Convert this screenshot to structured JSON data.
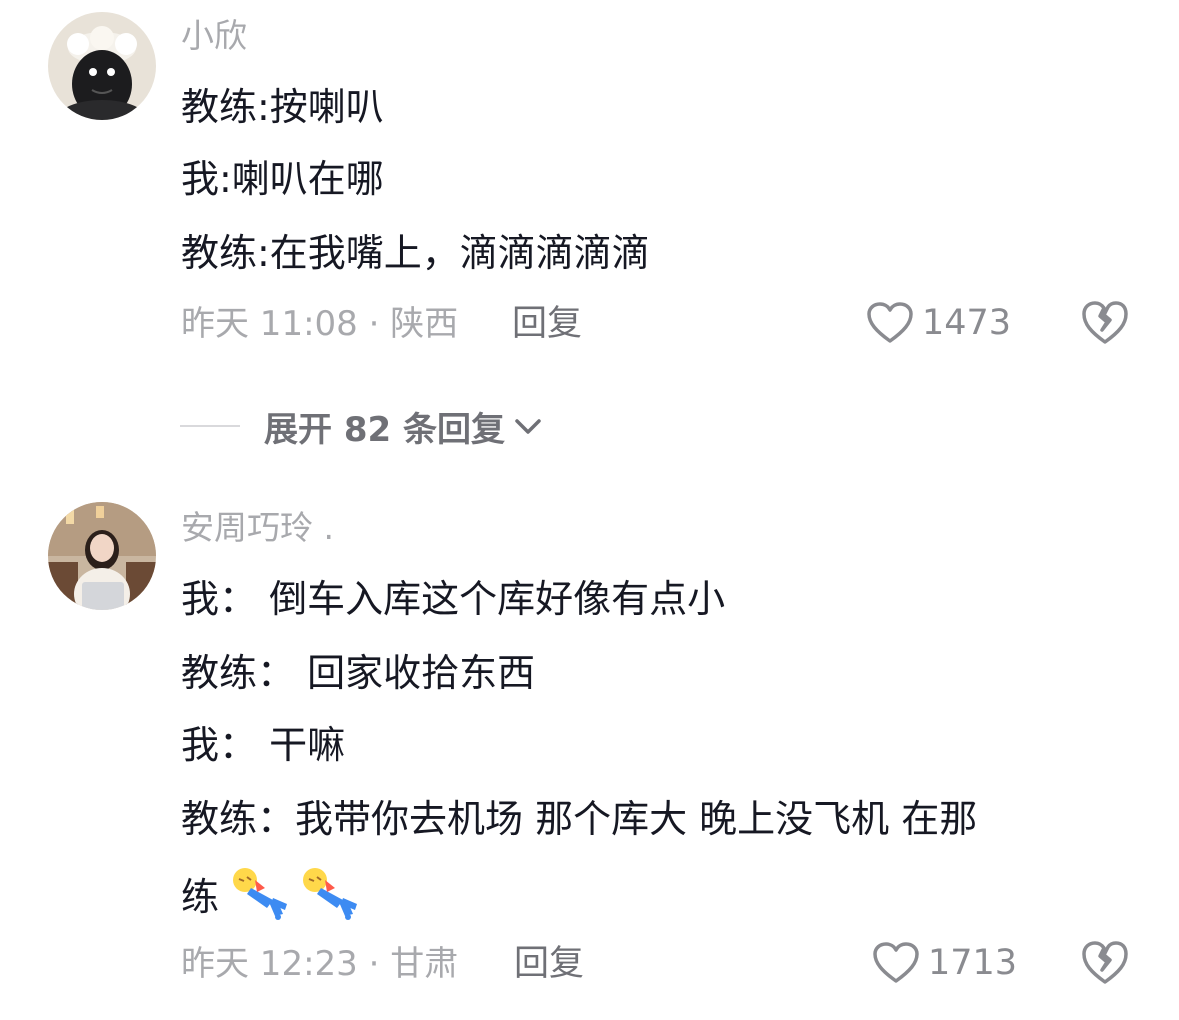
{
  "comments": [
    {
      "username": "小欣",
      "avatar_icon": "sheep-plush-avatar",
      "lines": [
        "教练:按喇叭",
        "我:喇叭在哪",
        "教练:在我嘴上，滴滴滴滴滴"
      ],
      "meta": "昨天 11:08 · 陕西",
      "reply_label": "回复",
      "likes": "1473",
      "expand_label": "展开 82 条回复"
    },
    {
      "username": "安周巧玲 .",
      "avatar_icon": "woman-laptop-avatar",
      "lines": [
        "我： 倒车入库这个库好像有点小",
        "教练：  回家收拾东西",
        "我： 干嘛",
        "教练：我带你去机场 那个库大 晚上没飞机 在那",
        "练"
      ],
      "emojis": [
        "lying-down-emoji",
        "lying-down-emoji"
      ],
      "meta": "昨天 12:23 · 甘肃",
      "reply_label": "回复",
      "likes": "1713"
    }
  ],
  "colors": {
    "text": "#161823",
    "meta": "#a8a9ad",
    "secondary": "#6f7076"
  }
}
